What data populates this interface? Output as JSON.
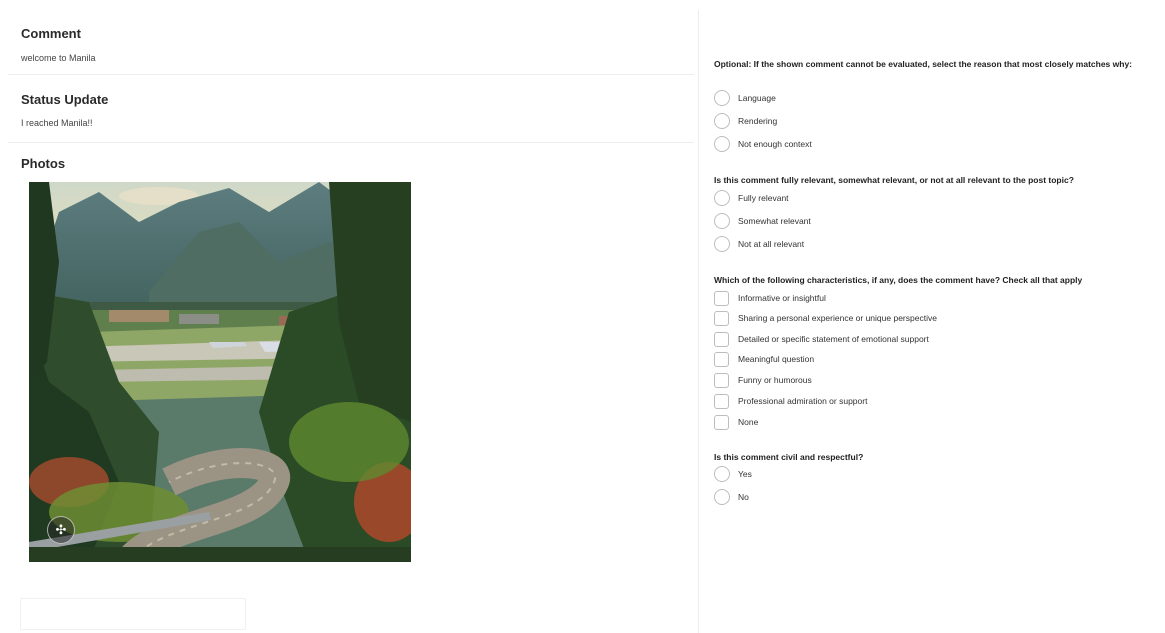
{
  "comment": {
    "title": "Comment",
    "body": "welcome to Manila"
  },
  "status_update": {
    "title": "Status Update",
    "body": "I reached Manila!!"
  },
  "photos": {
    "title": "Photos",
    "badge_icon": "sparkle-icon"
  },
  "questions": {
    "q1": {
      "title": "Optional: If the shown comment cannot be evaluated, select the reason that most closely matches why:",
      "options": [
        "Language",
        "Rendering",
        "Not enough context"
      ]
    },
    "q2": {
      "title": "Is this comment fully relevant, somewhat relevant, or not at all relevant to the post topic?",
      "options": [
        "Fully relevant",
        "Somewhat relevant",
        "Not at all relevant"
      ]
    },
    "q3": {
      "title": "Which of the following characteristics, if any, does the comment have? Check all that apply",
      "options": [
        "Informative or insightful",
        "Sharing a personal experience or unique perspective",
        "Detailed or specific statement of emotional support",
        "Meaningful question",
        "Funny or humorous",
        "Professional admiration or support",
        "None"
      ]
    },
    "q4": {
      "title": "Is this comment civil and respectful?",
      "options": [
        "Yes",
        "No"
      ]
    }
  }
}
